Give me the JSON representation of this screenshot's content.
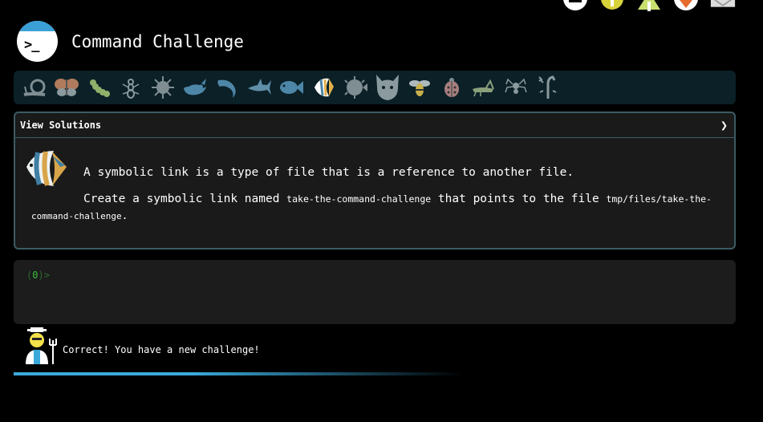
{
  "app": {
    "title": "Command Challenge"
  },
  "levels": {
    "items": [
      {
        "name": "snail",
        "color": "#7f8e92"
      },
      {
        "name": "moth",
        "color": "#9b8c7a"
      },
      {
        "name": "caterpillar",
        "color": "#7f9a64"
      },
      {
        "name": "ant",
        "color": "#8a9a9e"
      },
      {
        "name": "urchin",
        "color": "#7f8e92"
      },
      {
        "name": "whale",
        "color": "#4e86a8"
      },
      {
        "name": "dolphin",
        "color": "#4e86a8"
      },
      {
        "name": "shark",
        "color": "#5f8ea8"
      },
      {
        "name": "fish",
        "color": "#4e86a8"
      },
      {
        "name": "angelfish",
        "color": "#e3b04a",
        "current": true
      },
      {
        "name": "pufferfish",
        "color": "#7f8e92"
      },
      {
        "name": "cat",
        "color": "#8a9a9e"
      },
      {
        "name": "bee",
        "color": "#c9b04a"
      },
      {
        "name": "ladybug",
        "color": "#a87e7e"
      },
      {
        "name": "grasshopper",
        "color": "#8aa07a"
      },
      {
        "name": "spider",
        "color": "#8a9a9e"
      },
      {
        "name": "scorpion",
        "color": "#8a9a9e"
      }
    ]
  },
  "panel": {
    "header_label": "View Solutions",
    "chevron": "❯",
    "line1": "A symbolic link is a type of file that is a reference to another file.",
    "line2_prefix": "Create a symbolic link named ",
    "line2_code1": "take-the-command-challenge",
    "line2_mid": " that points to the file ",
    "line2_code2": "tmp/files/take-the-",
    "line3_code": "command-challenge",
    "line3_suffix": "."
  },
  "terminal": {
    "prompt_open": "(",
    "prompt_num": "0",
    "prompt_close": ")",
    "prompt_gt": ">"
  },
  "status": {
    "message": "Correct! You have a new challenge!"
  }
}
